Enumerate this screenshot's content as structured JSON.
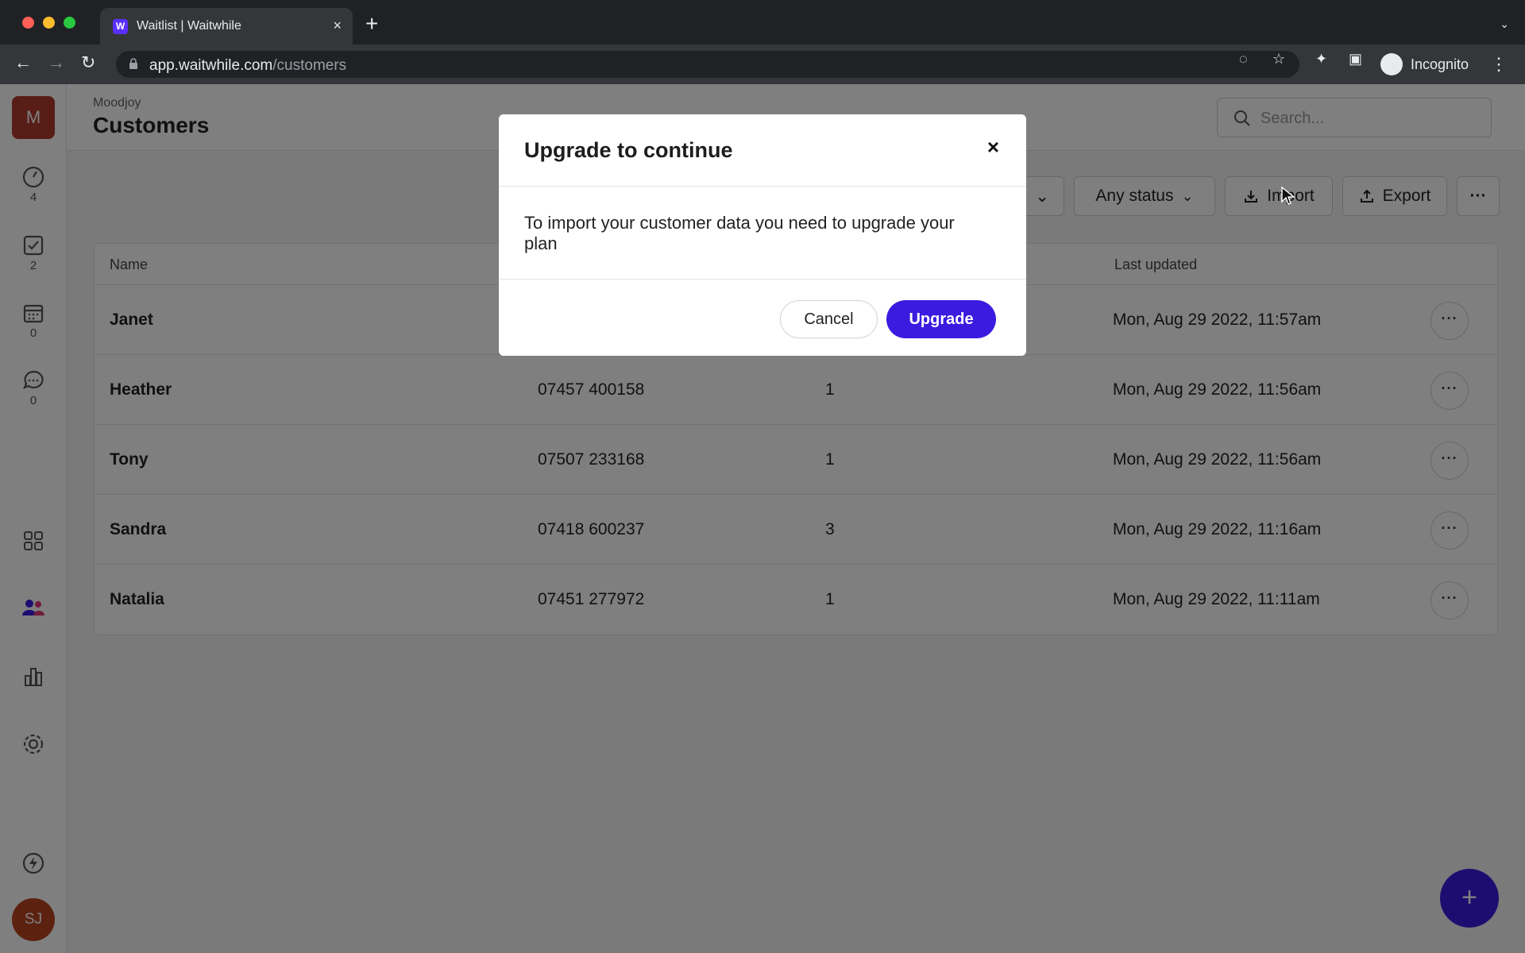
{
  "browser": {
    "tab_title": "Waitlist | Waitwhile",
    "favicon_letter": "W",
    "url_host": "app.waitwhile.com",
    "url_path": "/customers",
    "profile_label": "Incognito"
  },
  "sidebar": {
    "org_initial": "M",
    "items": [
      {
        "icon": "gauge-icon",
        "count": "4"
      },
      {
        "icon": "checkbox-icon",
        "count": "2"
      },
      {
        "icon": "calendar-icon",
        "count": "0"
      },
      {
        "icon": "chat-icon",
        "count": "0"
      },
      {
        "icon": "apps-grid-icon"
      },
      {
        "icon": "customers-icon"
      },
      {
        "icon": "bar-chart-icon"
      },
      {
        "icon": "gear-icon"
      }
    ],
    "bottom_icon": "lightning-icon",
    "user_initials": "SJ"
  },
  "header": {
    "breadcrumb": "Moodjoy",
    "title": "Customers",
    "search_placeholder": "Search..."
  },
  "filters": {
    "status_label": "Any status",
    "import_label": "Import",
    "export_label": "Export"
  },
  "table": {
    "columns": {
      "name": "Name",
      "last_updated": "Last updated"
    },
    "rows": [
      {
        "name": "Janet",
        "phone": "",
        "visits": "",
        "updated": "Mon, Aug 29 2022, 11:57am"
      },
      {
        "name": "Heather",
        "phone": "07457 400158",
        "visits": "1",
        "updated": "Mon, Aug 29 2022, 11:56am"
      },
      {
        "name": "Tony",
        "phone": "07507 233168",
        "visits": "1",
        "updated": "Mon, Aug 29 2022, 11:56am"
      },
      {
        "name": "Sandra",
        "phone": "07418 600237",
        "visits": "3",
        "updated": "Mon, Aug 29 2022, 11:16am"
      },
      {
        "name": "Natalia",
        "phone": "07451 277972",
        "visits": "1",
        "updated": "Mon, Aug 29 2022, 11:11am"
      }
    ],
    "row_menu_label": "···"
  },
  "fab_label": "+",
  "modal": {
    "title": "Upgrade to continue",
    "close_label": "×",
    "body": "To import your customer data you need to upgrade your plan",
    "cancel_label": "Cancel",
    "upgrade_label": "Upgrade"
  },
  "colors": {
    "accent": "#3c1be0",
    "org_avatar": "#b03a2e",
    "user_avatar": "#b8431f"
  }
}
